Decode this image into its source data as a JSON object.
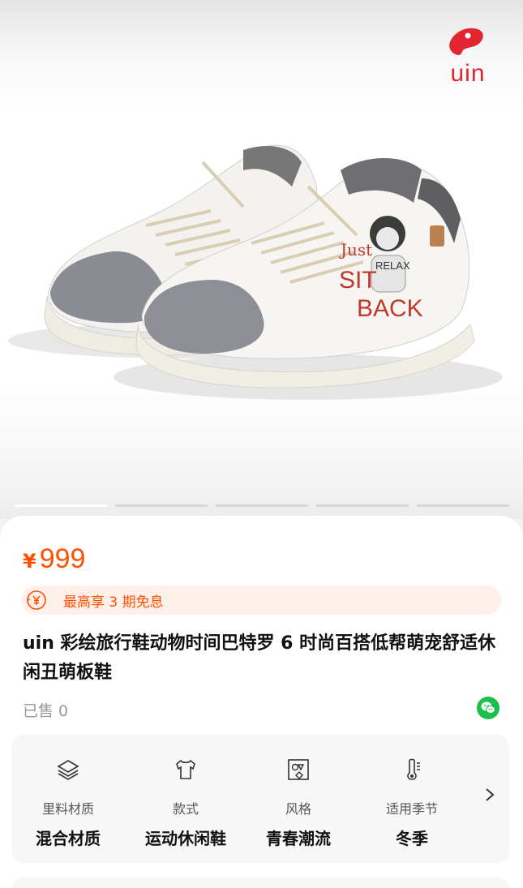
{
  "brand": {
    "logo_text": "uin",
    "color": "#e1262f"
  },
  "image": {
    "graphic_text": [
      "Just",
      "SIT",
      "RELAX",
      "BACK"
    ],
    "dots_total": 5,
    "active_index": 0
  },
  "price": {
    "currency": "¥",
    "value": "999",
    "color": "#ff5000"
  },
  "promo": {
    "icon": "yen-coin-icon",
    "text": "最高享 3 期免息"
  },
  "product": {
    "title": "uin 彩绘旅行鞋动物时间巴特罗 6 时尚百搭低帮萌宠舒适休闲丑萌板鞋"
  },
  "sales": {
    "text": "已售 0"
  },
  "attributes": [
    {
      "icon": "layers-icon",
      "label": "里料材质",
      "value": "混合材质"
    },
    {
      "icon": "shirt-icon",
      "label": "款式",
      "value": "运动休闲鞋"
    },
    {
      "icon": "shapes-icon",
      "label": "风格",
      "value": "青春潮流"
    },
    {
      "icon": "thermometer-icon",
      "label": "适用季节",
      "value": "冬季"
    }
  ]
}
